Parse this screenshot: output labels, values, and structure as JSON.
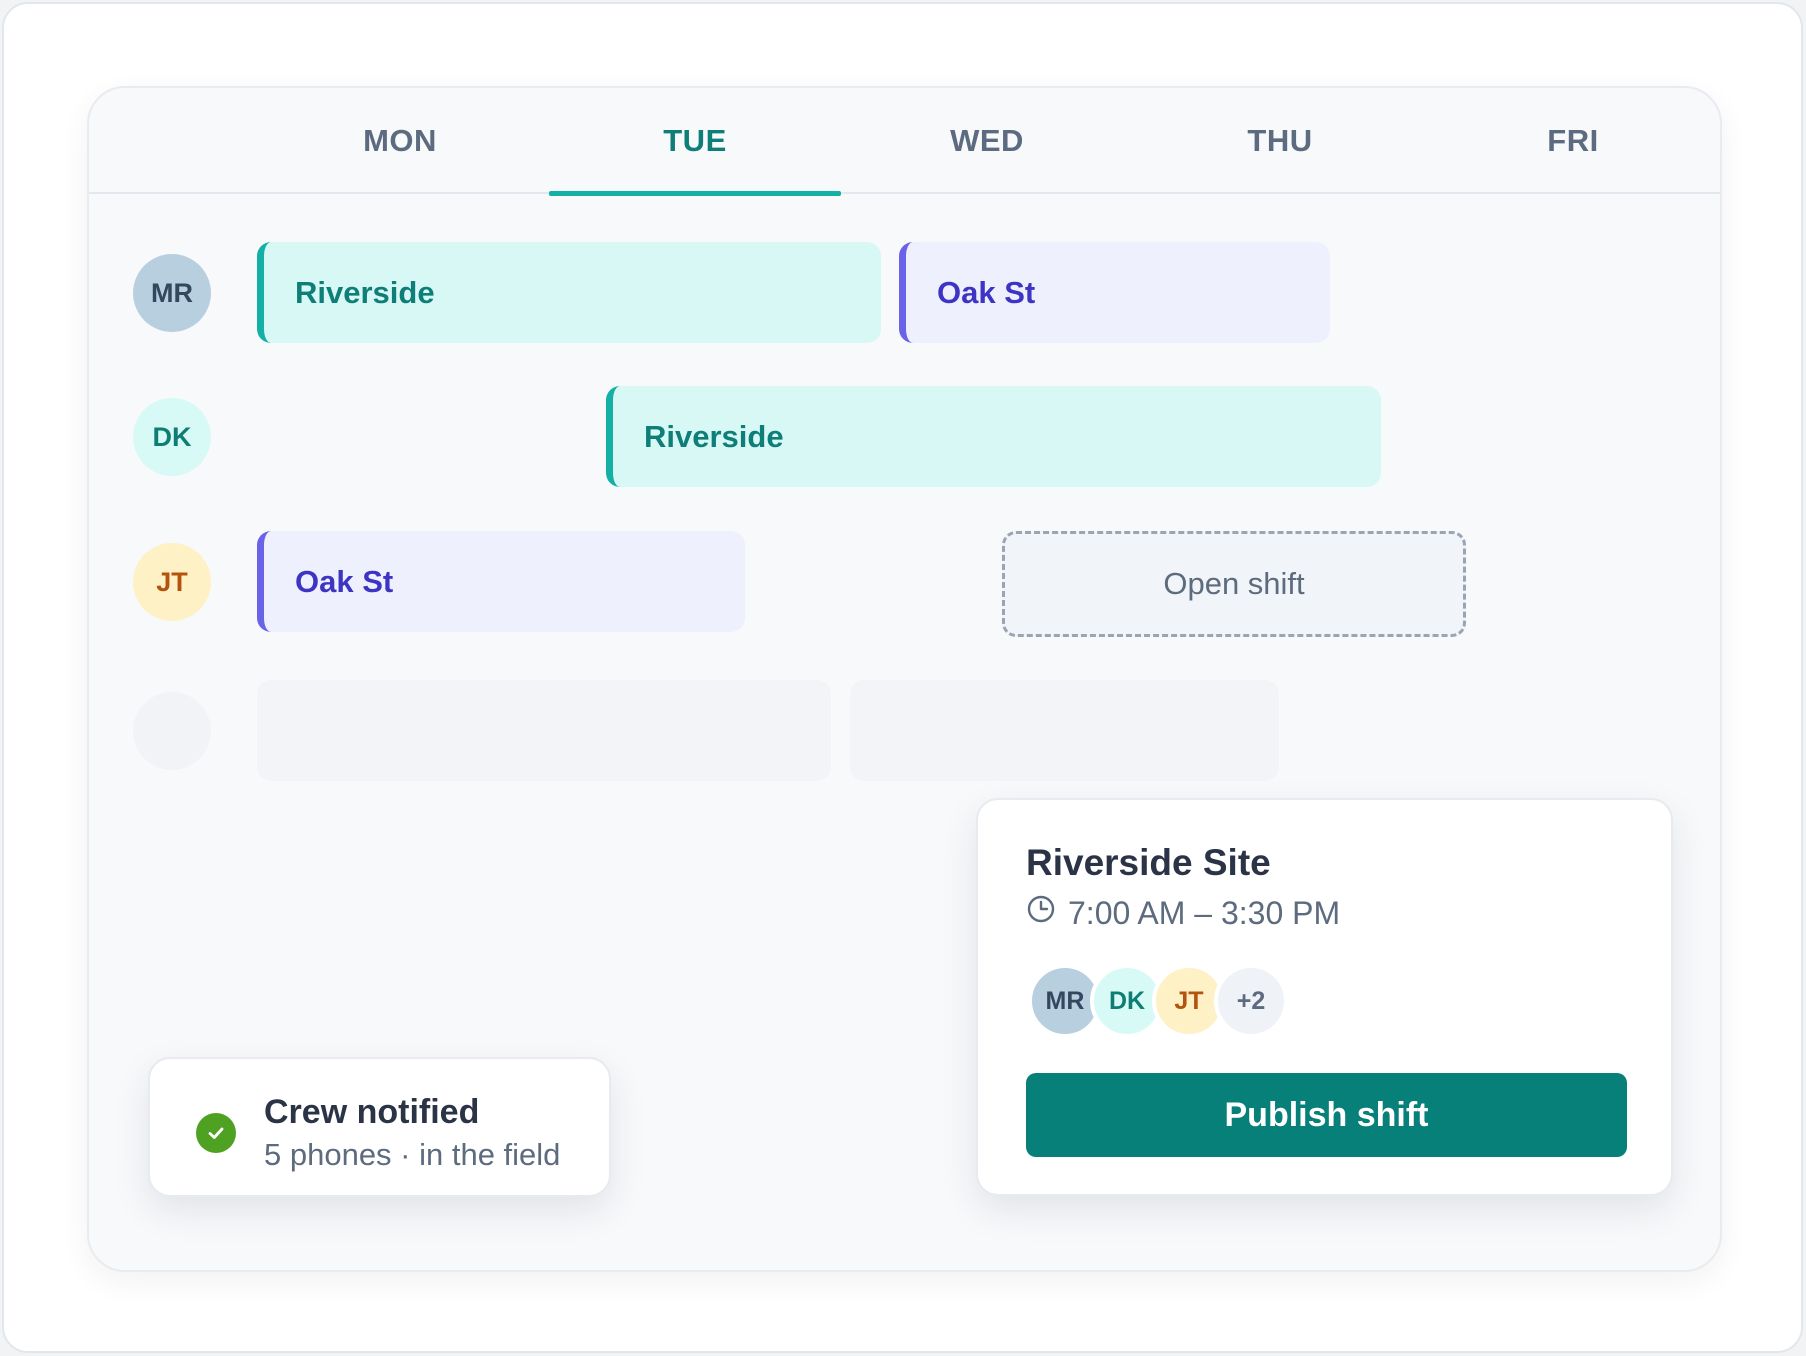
{
  "days": [
    "MON",
    "TUE",
    "WED",
    "THU",
    "FRI"
  ],
  "active_day": "TUE",
  "rows": [
    {
      "initials": "MR",
      "shifts": [
        "Riverside",
        "Oak St"
      ]
    },
    {
      "initials": "DK",
      "shifts": [
        "Riverside"
      ]
    },
    {
      "initials": "JT",
      "shifts": [
        "Oak St"
      ],
      "open_shift": "Open shift"
    }
  ],
  "detail": {
    "title": "Riverside Site",
    "time": "7:00 AM – 3:30 PM",
    "crew": [
      "MR",
      "DK",
      "JT"
    ],
    "more": "+2",
    "publish_label": "Publish shift"
  },
  "toast": {
    "title": "Crew notified",
    "subtitle": "5 phones · in the field"
  },
  "colors": {
    "accent": "#07807a",
    "teal": "#14b0a6",
    "indigo": "#6a63e8",
    "success": "#4fa121"
  }
}
